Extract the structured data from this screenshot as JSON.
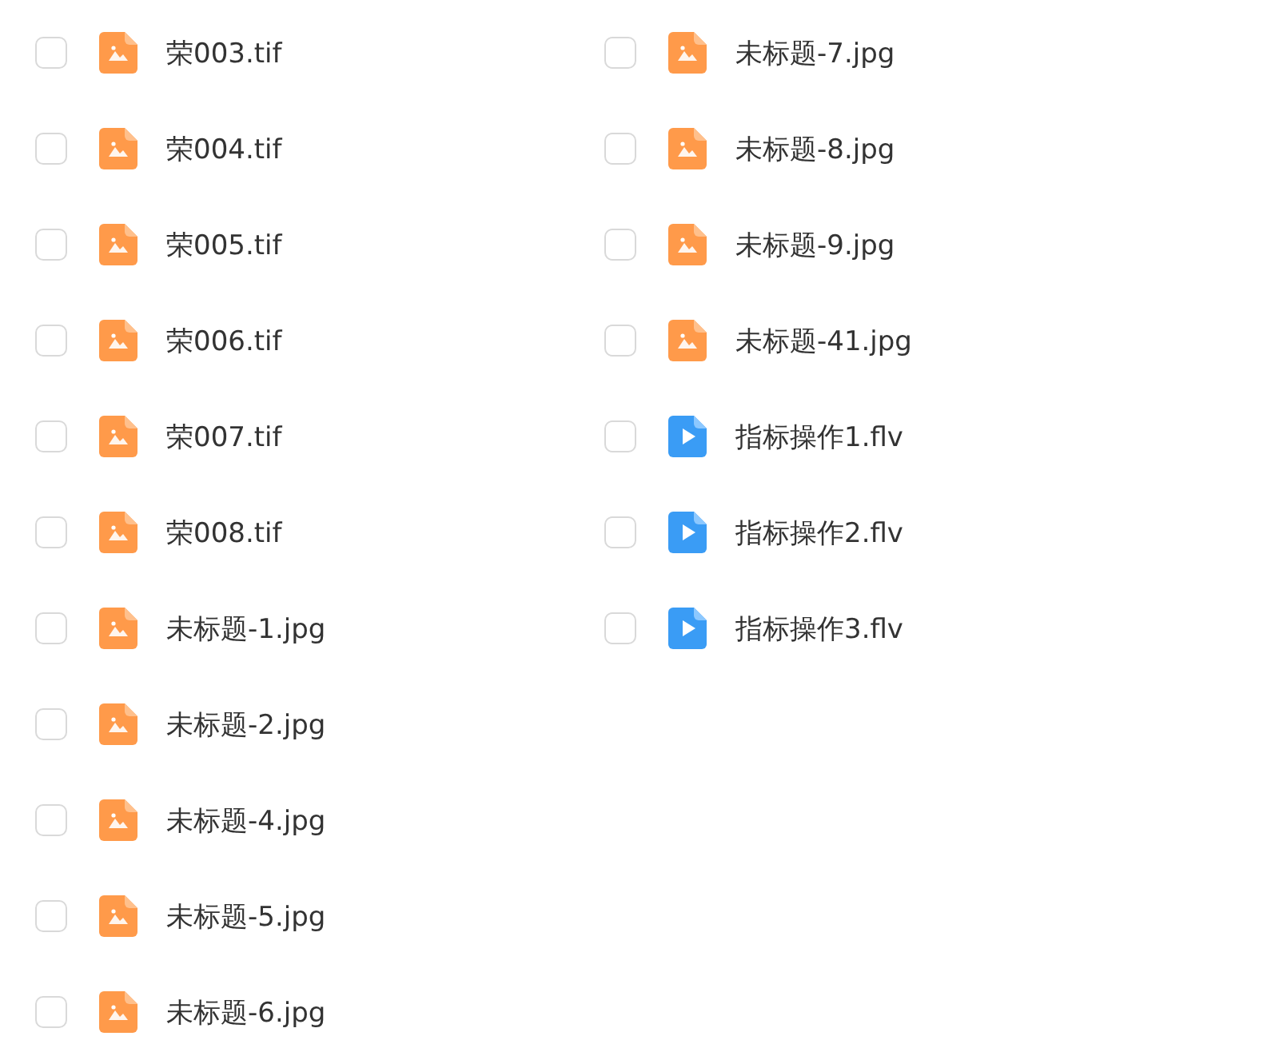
{
  "columns": [
    {
      "files": [
        {
          "name": "荣003.tif",
          "kind": "image",
          "checked": false
        },
        {
          "name": "荣004.tif",
          "kind": "image",
          "checked": false
        },
        {
          "name": "荣005.tif",
          "kind": "image",
          "checked": false
        },
        {
          "name": "荣006.tif",
          "kind": "image",
          "checked": false
        },
        {
          "name": "荣007.tif",
          "kind": "image",
          "checked": false
        },
        {
          "name": "荣008.tif",
          "kind": "image",
          "checked": false
        },
        {
          "name": "未标题-1.jpg",
          "kind": "image",
          "checked": false
        },
        {
          "name": "未标题-2.jpg",
          "kind": "image",
          "checked": false
        },
        {
          "name": "未标题-4.jpg",
          "kind": "image",
          "checked": false
        },
        {
          "name": "未标题-5.jpg",
          "kind": "image",
          "checked": false
        },
        {
          "name": "未标题-6.jpg",
          "kind": "image",
          "checked": false
        }
      ]
    },
    {
      "files": [
        {
          "name": "未标题-7.jpg",
          "kind": "image",
          "checked": false
        },
        {
          "name": "未标题-8.jpg",
          "kind": "image",
          "checked": false
        },
        {
          "name": "未标题-9.jpg",
          "kind": "image",
          "checked": false
        },
        {
          "name": "未标题-41.jpg",
          "kind": "image",
          "checked": false
        },
        {
          "name": "指标操作1.flv",
          "kind": "video",
          "checked": false
        },
        {
          "name": "指标操作2.flv",
          "kind": "video",
          "checked": false
        },
        {
          "name": "指标操作3.flv",
          "kind": "video",
          "checked": false
        }
      ]
    }
  ]
}
